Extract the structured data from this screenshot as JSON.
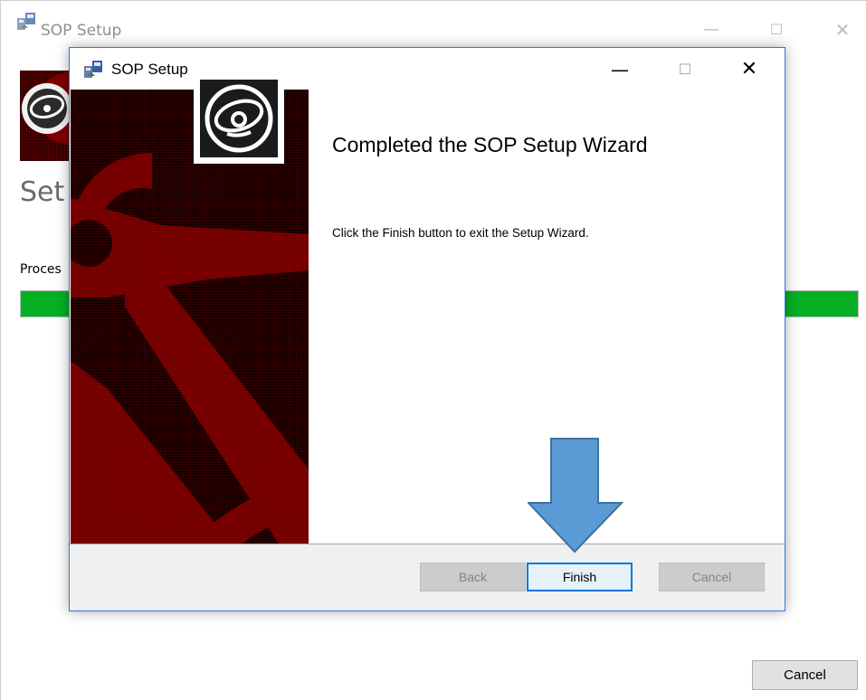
{
  "background_window": {
    "title": "SOP Setup",
    "heading": "Set",
    "status_text": "Proces",
    "progress_fraction": 1.0,
    "cancel_label": "Cancel"
  },
  "dialog": {
    "title": "SOP Setup",
    "heading": "Completed the SOP Setup Wizard",
    "body": "Click the Finish button to exit the Setup Wizard.",
    "buttons": {
      "back": "Back",
      "finish": "Finish",
      "cancel": "Cancel"
    }
  },
  "icons": {
    "app": "installer-icon",
    "disc": "cd-disc-icon",
    "minimize": "minimize-icon",
    "maximize": "maximize-icon",
    "close": "close-icon",
    "annotation": "down-arrow-icon"
  },
  "colors": {
    "progress": "#06b025",
    "banner_dark": "#1b0000",
    "banner_red": "#7a0000",
    "accent": "#0078d7",
    "arrow_fill": "#5b9bd5",
    "arrow_stroke": "#41719c"
  }
}
